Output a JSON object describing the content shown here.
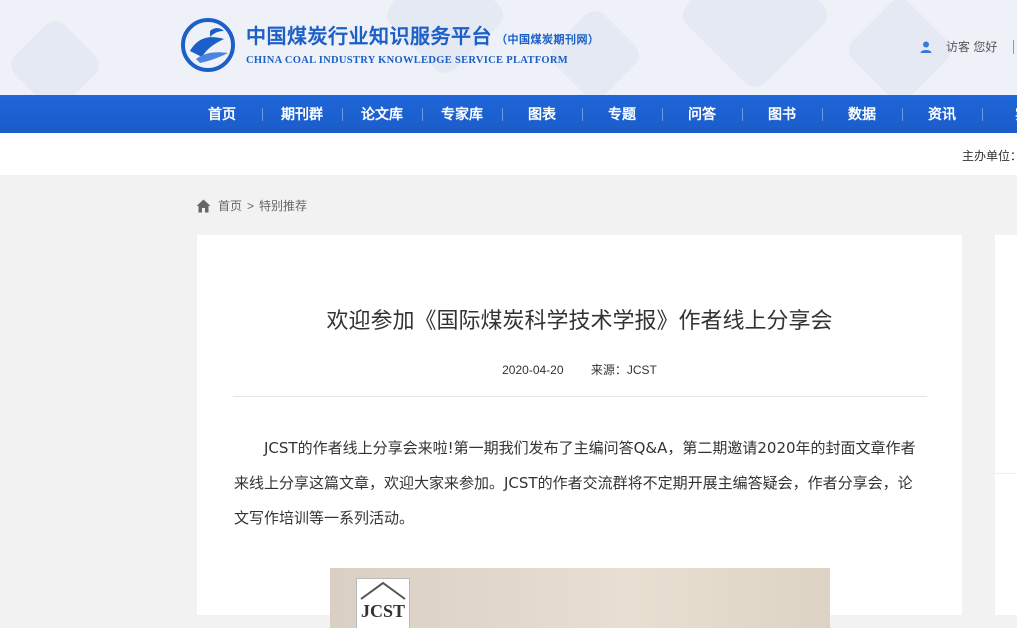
{
  "header": {
    "site_name_cn": "中国煤炭行业知识服务平台",
    "site_name_sub": "（中国煤炭期刊网）",
    "site_name_en": "CHINA COAL INDUSTRY KNOWLEDGE SERVICE PLATFORM",
    "visitor_text": "访客 您好"
  },
  "nav": {
    "items": [
      "首页",
      "期刊群",
      "论文库",
      "专家库",
      "图表",
      "专题",
      "问答",
      "图书",
      "数据",
      "资讯",
      "实"
    ]
  },
  "subbar": {
    "host_label": "主办单位："
  },
  "breadcrumb": {
    "home": "首页",
    "separator": ">",
    "current": "特别推荐"
  },
  "article": {
    "title": "欢迎参加《国际煤炭科学技术学报》作者线上分享会",
    "date": "2020-04-20",
    "source": "来源：JCST",
    "body": "JCST的作者线上分享会来啦!第一期我们发布了主编问答Q&A，第二期邀请2020年的封面文章作者来线上分享这篇文章，欢迎大家来参加。JCST的作者交流群将不定期开展主编答疑会，作者分享会，论文写作培训等一系列活动。",
    "image_logo_text": "JCST"
  },
  "colors": {
    "brand_blue": "#1c5fc6",
    "nav_blue": "#1f66d9"
  }
}
